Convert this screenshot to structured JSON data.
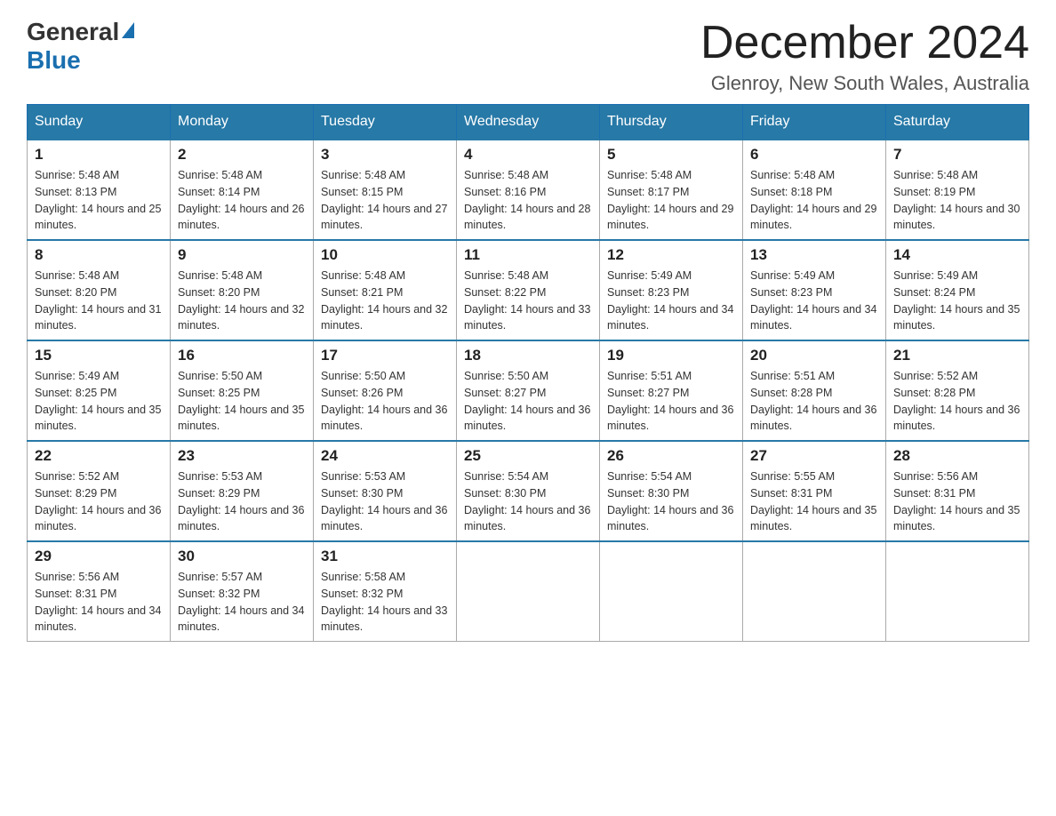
{
  "header": {
    "logo_general": "General",
    "logo_blue": "Blue",
    "month_title": "December 2024",
    "location": "Glenroy, New South Wales, Australia"
  },
  "weekdays": [
    "Sunday",
    "Monday",
    "Tuesday",
    "Wednesday",
    "Thursday",
    "Friday",
    "Saturday"
  ],
  "weeks": [
    [
      {
        "day": "1",
        "sunrise": "5:48 AM",
        "sunset": "8:13 PM",
        "daylight": "14 hours and 25 minutes."
      },
      {
        "day": "2",
        "sunrise": "5:48 AM",
        "sunset": "8:14 PM",
        "daylight": "14 hours and 26 minutes."
      },
      {
        "day": "3",
        "sunrise": "5:48 AM",
        "sunset": "8:15 PM",
        "daylight": "14 hours and 27 minutes."
      },
      {
        "day": "4",
        "sunrise": "5:48 AM",
        "sunset": "8:16 PM",
        "daylight": "14 hours and 28 minutes."
      },
      {
        "day": "5",
        "sunrise": "5:48 AM",
        "sunset": "8:17 PM",
        "daylight": "14 hours and 29 minutes."
      },
      {
        "day": "6",
        "sunrise": "5:48 AM",
        "sunset": "8:18 PM",
        "daylight": "14 hours and 29 minutes."
      },
      {
        "day": "7",
        "sunrise": "5:48 AM",
        "sunset": "8:19 PM",
        "daylight": "14 hours and 30 minutes."
      }
    ],
    [
      {
        "day": "8",
        "sunrise": "5:48 AM",
        "sunset": "8:20 PM",
        "daylight": "14 hours and 31 minutes."
      },
      {
        "day": "9",
        "sunrise": "5:48 AM",
        "sunset": "8:20 PM",
        "daylight": "14 hours and 32 minutes."
      },
      {
        "day": "10",
        "sunrise": "5:48 AM",
        "sunset": "8:21 PM",
        "daylight": "14 hours and 32 minutes."
      },
      {
        "day": "11",
        "sunrise": "5:48 AM",
        "sunset": "8:22 PM",
        "daylight": "14 hours and 33 minutes."
      },
      {
        "day": "12",
        "sunrise": "5:49 AM",
        "sunset": "8:23 PM",
        "daylight": "14 hours and 34 minutes."
      },
      {
        "day": "13",
        "sunrise": "5:49 AM",
        "sunset": "8:23 PM",
        "daylight": "14 hours and 34 minutes."
      },
      {
        "day": "14",
        "sunrise": "5:49 AM",
        "sunset": "8:24 PM",
        "daylight": "14 hours and 35 minutes."
      }
    ],
    [
      {
        "day": "15",
        "sunrise": "5:49 AM",
        "sunset": "8:25 PM",
        "daylight": "14 hours and 35 minutes."
      },
      {
        "day": "16",
        "sunrise": "5:50 AM",
        "sunset": "8:25 PM",
        "daylight": "14 hours and 35 minutes."
      },
      {
        "day": "17",
        "sunrise": "5:50 AM",
        "sunset": "8:26 PM",
        "daylight": "14 hours and 36 minutes."
      },
      {
        "day": "18",
        "sunrise": "5:50 AM",
        "sunset": "8:27 PM",
        "daylight": "14 hours and 36 minutes."
      },
      {
        "day": "19",
        "sunrise": "5:51 AM",
        "sunset": "8:27 PM",
        "daylight": "14 hours and 36 minutes."
      },
      {
        "day": "20",
        "sunrise": "5:51 AM",
        "sunset": "8:28 PM",
        "daylight": "14 hours and 36 minutes."
      },
      {
        "day": "21",
        "sunrise": "5:52 AM",
        "sunset": "8:28 PM",
        "daylight": "14 hours and 36 minutes."
      }
    ],
    [
      {
        "day": "22",
        "sunrise": "5:52 AM",
        "sunset": "8:29 PM",
        "daylight": "14 hours and 36 minutes."
      },
      {
        "day": "23",
        "sunrise": "5:53 AM",
        "sunset": "8:29 PM",
        "daylight": "14 hours and 36 minutes."
      },
      {
        "day": "24",
        "sunrise": "5:53 AM",
        "sunset": "8:30 PM",
        "daylight": "14 hours and 36 minutes."
      },
      {
        "day": "25",
        "sunrise": "5:54 AM",
        "sunset": "8:30 PM",
        "daylight": "14 hours and 36 minutes."
      },
      {
        "day": "26",
        "sunrise": "5:54 AM",
        "sunset": "8:30 PM",
        "daylight": "14 hours and 36 minutes."
      },
      {
        "day": "27",
        "sunrise": "5:55 AM",
        "sunset": "8:31 PM",
        "daylight": "14 hours and 35 minutes."
      },
      {
        "day": "28",
        "sunrise": "5:56 AM",
        "sunset": "8:31 PM",
        "daylight": "14 hours and 35 minutes."
      }
    ],
    [
      {
        "day": "29",
        "sunrise": "5:56 AM",
        "sunset": "8:31 PM",
        "daylight": "14 hours and 34 minutes."
      },
      {
        "day": "30",
        "sunrise": "5:57 AM",
        "sunset": "8:32 PM",
        "daylight": "14 hours and 34 minutes."
      },
      {
        "day": "31",
        "sunrise": "5:58 AM",
        "sunset": "8:32 PM",
        "daylight": "14 hours and 33 minutes."
      },
      null,
      null,
      null,
      null
    ]
  ],
  "labels": {
    "sunrise": "Sunrise:",
    "sunset": "Sunset:",
    "daylight": "Daylight:"
  }
}
